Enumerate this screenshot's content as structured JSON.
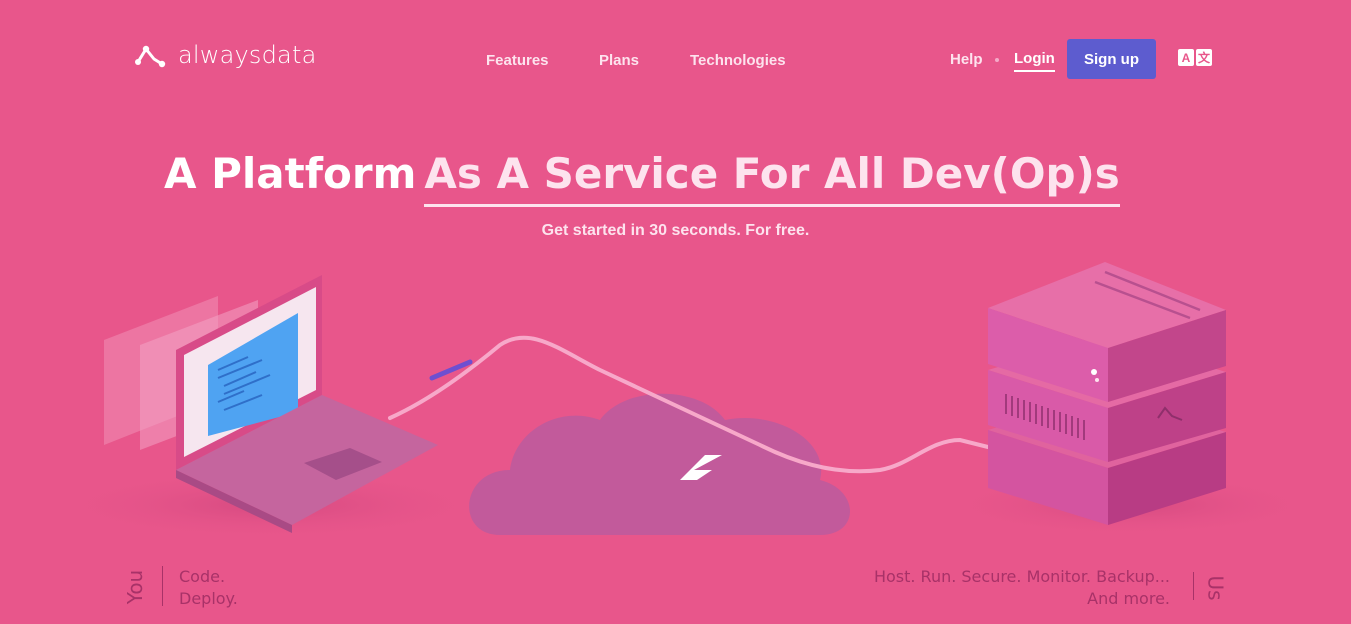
{
  "brand": {
    "name": "alwaysdata",
    "logo_icon": "alwaysdata-logo-icon"
  },
  "nav": {
    "features": "Features",
    "plans": "Plans",
    "technologies": "Technologies"
  },
  "header": {
    "help": "Help",
    "login": "Login",
    "signup": "Sign up",
    "lang_a": "A",
    "lang_b": "文"
  },
  "hero": {
    "title_lead": "A Platform",
    "title_accent": "As A Service For All Dev(Op)s",
    "subtitle": "Get started in 30 seconds. For free."
  },
  "footer": {
    "you_label": "You",
    "you_line1": "Code.",
    "you_line2": "Deploy.",
    "us_line1": "Host. Run. Secure. Monitor. Backup...",
    "us_line2": "And more.",
    "us_label": "Us"
  },
  "colors": {
    "background": "#e8568b",
    "signup": "#5d5ccf",
    "muted_text": "#a83268"
  }
}
